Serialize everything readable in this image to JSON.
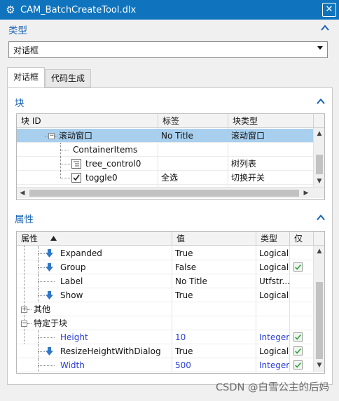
{
  "window": {
    "title": "CAM_BatchCreateTool.dlx",
    "close_label": "✕"
  },
  "type_section": {
    "label": "类型",
    "select_value": "对话框"
  },
  "tabs": [
    {
      "label": "对话框"
    },
    {
      "label": "代码生成"
    }
  ],
  "blocks_section": {
    "label": "块",
    "columns": [
      "块 ID",
      "标签",
      "块类型"
    ],
    "rows": [
      {
        "id": "滚动窗口",
        "label": "No Title",
        "type": "滚动窗口"
      },
      {
        "id": "ContainerItems",
        "label": "",
        "type": ""
      },
      {
        "id": "tree_control0",
        "label": "",
        "type": "树列表"
      },
      {
        "id": "toggle0",
        "label": "全选",
        "type": "切换开关"
      }
    ]
  },
  "props_section": {
    "label": "属性",
    "columns": [
      "属性",
      "值",
      "类型",
      "仅"
    ],
    "rows": [
      {
        "name": "Expanded",
        "value": "True",
        "type": "Logical",
        "only": false,
        "icon": "arrow-down-icon",
        "blue": false
      },
      {
        "name": "Group",
        "value": "False",
        "type": "Logical",
        "only": true,
        "icon": "arrow-down-icon",
        "blue": false
      },
      {
        "name": "Label",
        "value": "No Title",
        "type": "Utfstr...",
        "only": false,
        "icon": "",
        "blue": false
      },
      {
        "name": "Show",
        "value": "True",
        "type": "Logical",
        "only": false,
        "icon": "arrow-down-icon",
        "blue": false
      },
      {
        "name": "其他",
        "value": "",
        "type": "",
        "only": false,
        "icon": "",
        "group": true,
        "collapsed": true
      },
      {
        "name": "特定于块",
        "value": "",
        "type": "",
        "only": false,
        "icon": "",
        "group": true,
        "collapsed": false
      },
      {
        "name": "Height",
        "value": "10",
        "type": "Integer",
        "only": true,
        "icon": "",
        "blue": true
      },
      {
        "name": "ResizeHeightWithDialog",
        "value": "True",
        "type": "Logical",
        "only": true,
        "icon": "arrow-down-icon",
        "blue": false
      },
      {
        "name": "Width",
        "value": "500",
        "type": "Integer",
        "only": true,
        "icon": "",
        "blue": true
      }
    ]
  },
  "watermark": "CSDN @白雪公主的后妈",
  "colors": {
    "titlebar": "#0f74bd",
    "section_label": "#1a64b4",
    "selected_row": "#a8cfee",
    "blue_text": "#2a3ed8"
  }
}
